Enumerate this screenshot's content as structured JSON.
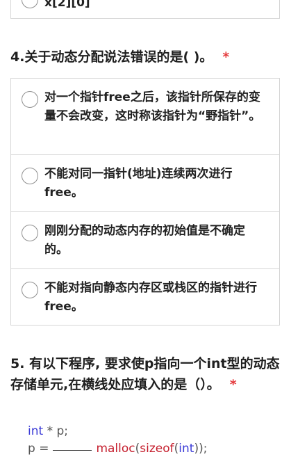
{
  "q3": {
    "partial_option": "x[2][0]"
  },
  "q4": {
    "title": "4.关于动态分配说法错误的是( )。",
    "required_mark": "*",
    "options": [
      "对一个指针free之后，该指针所保存的变量不会改变，这时称该指针为“野指针”。",
      "不能对同一指针(地址)连续两次进行free。",
      "刚刚分配的动态内存的初始值是不确定的。",
      "不能对指向静态内存区或栈区的指针进行free。"
    ]
  },
  "q5": {
    "title": "5. 有以下程序, 要求使p指向一个int型的动态存储单元,在横线处应填入的是（）。",
    "required_mark": "*",
    "code": {
      "line1": {
        "kw": "int",
        "rest": " * p;"
      },
      "line2": {
        "lhs": "p =",
        "fn": "malloc",
        "paren1": "(",
        "fn2": "sizeof",
        "paren2": "(",
        "kw": "int",
        "tail": "));"
      }
    }
  }
}
